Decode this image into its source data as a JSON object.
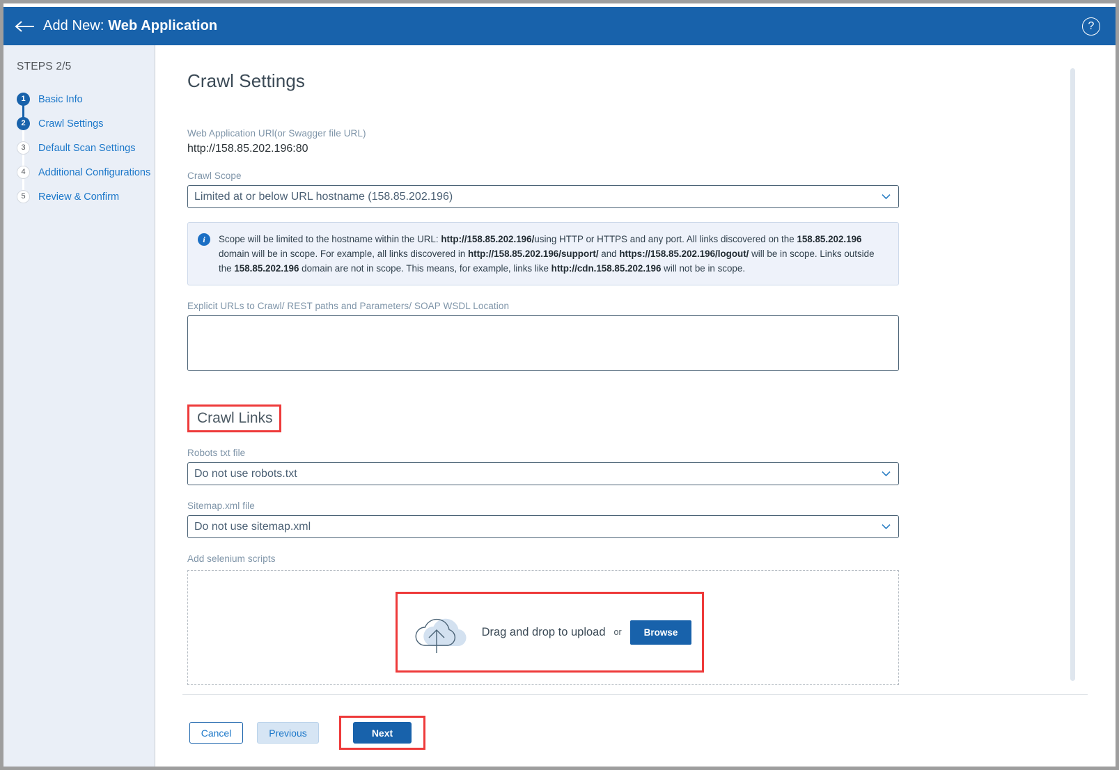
{
  "header": {
    "back_icon": "back-arrow-icon",
    "prefix": "Add New:",
    "title": "Web Application",
    "help_icon": "?"
  },
  "sidebar": {
    "steps_label": "STEPS 2/5",
    "items": [
      {
        "num": "1",
        "label": "Basic Info",
        "state": "done"
      },
      {
        "num": "2",
        "label": "Crawl Settings",
        "state": "current"
      },
      {
        "num": "3",
        "label": "Default Scan Settings",
        "state": "todo"
      },
      {
        "num": "4",
        "label": "Additional Configurations",
        "state": "todo"
      },
      {
        "num": "5",
        "label": "Review & Confirm",
        "state": "todo"
      }
    ]
  },
  "main": {
    "page_title": "Crawl Settings",
    "url_field": {
      "label": "Web Application URl(or Swagger file URL)",
      "value": "http://158.85.202.196:80"
    },
    "crawl_scope": {
      "label": "Crawl Scope",
      "value": "Limited at or below URL hostname (158.85.202.196)"
    },
    "info": {
      "icon": "info-icon",
      "p1": "Scope will be limited to the hostname within the URL: ",
      "b1": "http://158.85.202.196/",
      "p2": "using HTTP or HTTPS and any port. All links discovered on the ",
      "b2": "158.85.202.196",
      "p3": " domain will be in scope. For example, all links discovered in ",
      "b3": "http://158.85.202.196/support/",
      "p4": " and ",
      "b4": "https://158.85.202.196/logout/",
      "p5": " will be in scope. Links outside the ",
      "b5": "158.85.202.196",
      "p6": " domain are not in scope. This means, for example, links like ",
      "b6": "http://cdn.158.85.202.196",
      "p7": " will not be in scope."
    },
    "explicit_urls": {
      "label": "Explicit URLs to Crawl/ REST paths and Parameters/ SOAP WSDL Location",
      "value": "",
      "placeholder": ""
    },
    "crawl_links_heading": "Crawl Links",
    "robots": {
      "label": "Robots txt file",
      "value": "Do not use robots.txt"
    },
    "sitemap": {
      "label": "Sitemap.xml file",
      "value": "Do not use sitemap.xml"
    },
    "selenium": {
      "label": "Add selenium scripts",
      "cloud_icon": "cloud-upload-icon",
      "drop_text": "Drag and drop to upload",
      "or_text": "or",
      "browse_label": "Browse"
    }
  },
  "footer": {
    "cancel_label": "Cancel",
    "previous_label": "Previous",
    "next_label": "Next"
  },
  "colors": {
    "header_blue": "#1862ab",
    "link_blue": "#1b77c9",
    "sidebar_bg": "#eaeff7",
    "annotation_red": "#ee3a3a",
    "info_bg": "#eef2fa"
  }
}
